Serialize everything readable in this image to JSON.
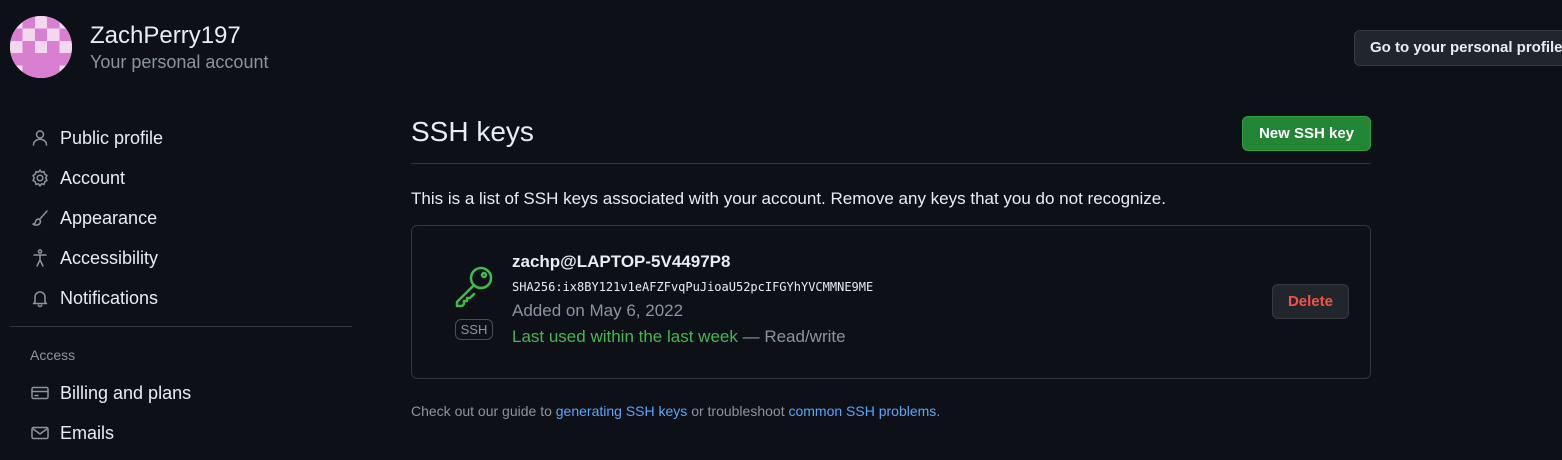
{
  "user": {
    "name": "ZachPerry197",
    "subtitle": "Your personal account",
    "profile_button": "Go to your personal profile"
  },
  "sidebar": {
    "items": [
      {
        "label": "Public profile",
        "icon": "person-icon"
      },
      {
        "label": "Account",
        "icon": "gear-icon"
      },
      {
        "label": "Appearance",
        "icon": "paintbrush-icon"
      },
      {
        "label": "Accessibility",
        "icon": "accessibility-icon"
      },
      {
        "label": "Notifications",
        "icon": "bell-icon"
      }
    ],
    "section_label": "Access",
    "access_items": [
      {
        "label": "Billing and plans",
        "icon": "credit-card-icon"
      },
      {
        "label": "Emails",
        "icon": "mail-icon"
      }
    ]
  },
  "main": {
    "title": "SSH keys",
    "new_button": "New SSH key",
    "intro": "This is a list of SSH keys associated with your account. Remove any keys that you do not recognize.",
    "key": {
      "tag": "SSH",
      "title": "zachp@LAPTOP-5V4497P8",
      "fingerprint": "SHA256:ix8BY121v1eAFZFvqPuJioaU52pcIFGYhYVCMMNE9ME",
      "added": "Added on May 6, 2022",
      "last_used": "Last used within the last week",
      "access": "— Read/write",
      "delete_label": "Delete"
    },
    "guide": {
      "prefix": "Check out our guide to",
      "link1": "generating SSH keys",
      "middle": "or troubleshoot",
      "link2": "common SSH problems",
      "suffix": "."
    }
  },
  "colors": {
    "background": "#0d1117",
    "primary_button": "#238636",
    "link": "#58a6ff",
    "danger": "#f85149",
    "success": "#3fb950"
  }
}
